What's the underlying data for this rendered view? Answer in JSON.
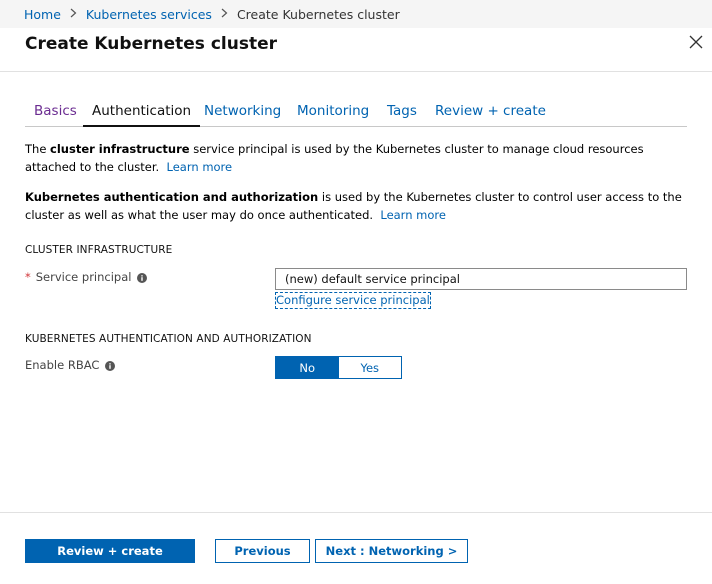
{
  "breadcrumb": {
    "items": [
      "Home",
      "Kubernetes services"
    ],
    "current": "Create Kubernetes cluster"
  },
  "page": {
    "title": "Create Kubernetes cluster"
  },
  "tabs": [
    {
      "label": "Basics",
      "state": "visited"
    },
    {
      "label": "Authentication",
      "state": "active"
    },
    {
      "label": "Networking",
      "state": "default"
    },
    {
      "label": "Monitoring",
      "state": "default"
    },
    {
      "label": "Tags",
      "state": "default"
    },
    {
      "label": "Review + create",
      "state": "default"
    }
  ],
  "intro": {
    "p1": {
      "pre": "The ",
      "bold": "cluster infrastructure",
      "post": " service principal is used by the Kubernetes cluster to manage cloud resources attached to the cluster.",
      "link": "Learn more"
    },
    "p2": {
      "bold": "Kubernetes authentication and authorization",
      "post": " is used by the Kubernetes cluster to control user access to the cluster as well as what the user may do once authenticated.",
      "link": "Learn more"
    }
  },
  "cluster_infrastructure": {
    "header": "CLUSTER INFRASTRUCTURE",
    "service_principal": {
      "required_mark": "*",
      "label": "Service principal",
      "value": "(new) default service principal",
      "configure_link": "Configure service principal"
    }
  },
  "k8s_auth": {
    "header": "KUBERNETES AUTHENTICATION AND AUTHORIZATION",
    "rbac": {
      "label": "Enable RBAC",
      "options": [
        "No",
        "Yes"
      ],
      "selected": "No"
    }
  },
  "footer": {
    "review_create": "Review + create",
    "previous": "Previous",
    "next": "Next : Networking >"
  },
  "colors": {
    "accent": "#0063b1",
    "visited_tab": "#6b2c91",
    "required": "#d13438"
  },
  "icons": {
    "close": "close-icon",
    "info": "info-icon",
    "chevron": "chevron-right-icon"
  }
}
